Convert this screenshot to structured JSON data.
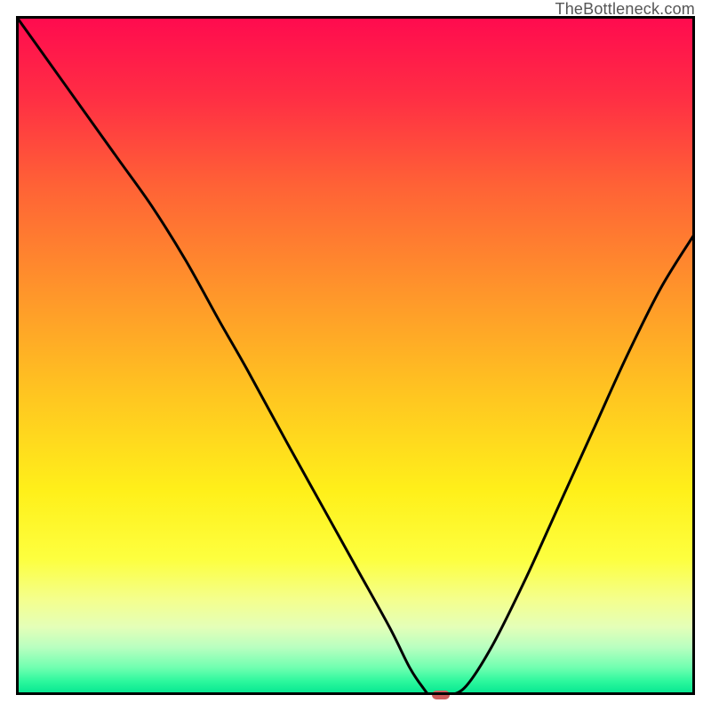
{
  "watermark": "TheBottleneck.com",
  "chart_data": {
    "type": "line",
    "title": "",
    "xlabel": "",
    "ylabel": "",
    "xlim": [
      0,
      100
    ],
    "ylim": [
      0,
      100
    ],
    "grid": false,
    "series": [
      {
        "name": "curve",
        "x": [
          0,
          5,
          10,
          15,
          20,
          25,
          30,
          34,
          40,
          45,
          50,
          55,
          58,
          60,
          61,
          63,
          66,
          70,
          75,
          80,
          85,
          90,
          95,
          100
        ],
        "y": [
          100,
          93,
          86,
          79,
          72,
          64,
          55,
          48,
          37,
          28,
          19,
          10,
          4,
          1,
          0,
          0,
          1,
          7,
          17,
          28,
          39,
          50,
          60,
          68
        ]
      }
    ],
    "marker": {
      "x": 62.5,
      "y": 0,
      "color": "#cf5c5c"
    },
    "background_gradient": {
      "stops": [
        {
          "pct": 0,
          "color": "#ff0a4f"
        },
        {
          "pct": 12,
          "color": "#ff2e44"
        },
        {
          "pct": 25,
          "color": "#ff6236"
        },
        {
          "pct": 40,
          "color": "#ff932b"
        },
        {
          "pct": 55,
          "color": "#ffc321"
        },
        {
          "pct": 70,
          "color": "#fff01a"
        },
        {
          "pct": 80,
          "color": "#fdff3f"
        },
        {
          "pct": 86,
          "color": "#f4ff8e"
        },
        {
          "pct": 90,
          "color": "#e4ffb8"
        },
        {
          "pct": 93,
          "color": "#b8ffc0"
        },
        {
          "pct": 96,
          "color": "#6fffb0"
        },
        {
          "pct": 98,
          "color": "#2cf79d"
        },
        {
          "pct": 100,
          "color": "#00e58f"
        }
      ]
    }
  }
}
